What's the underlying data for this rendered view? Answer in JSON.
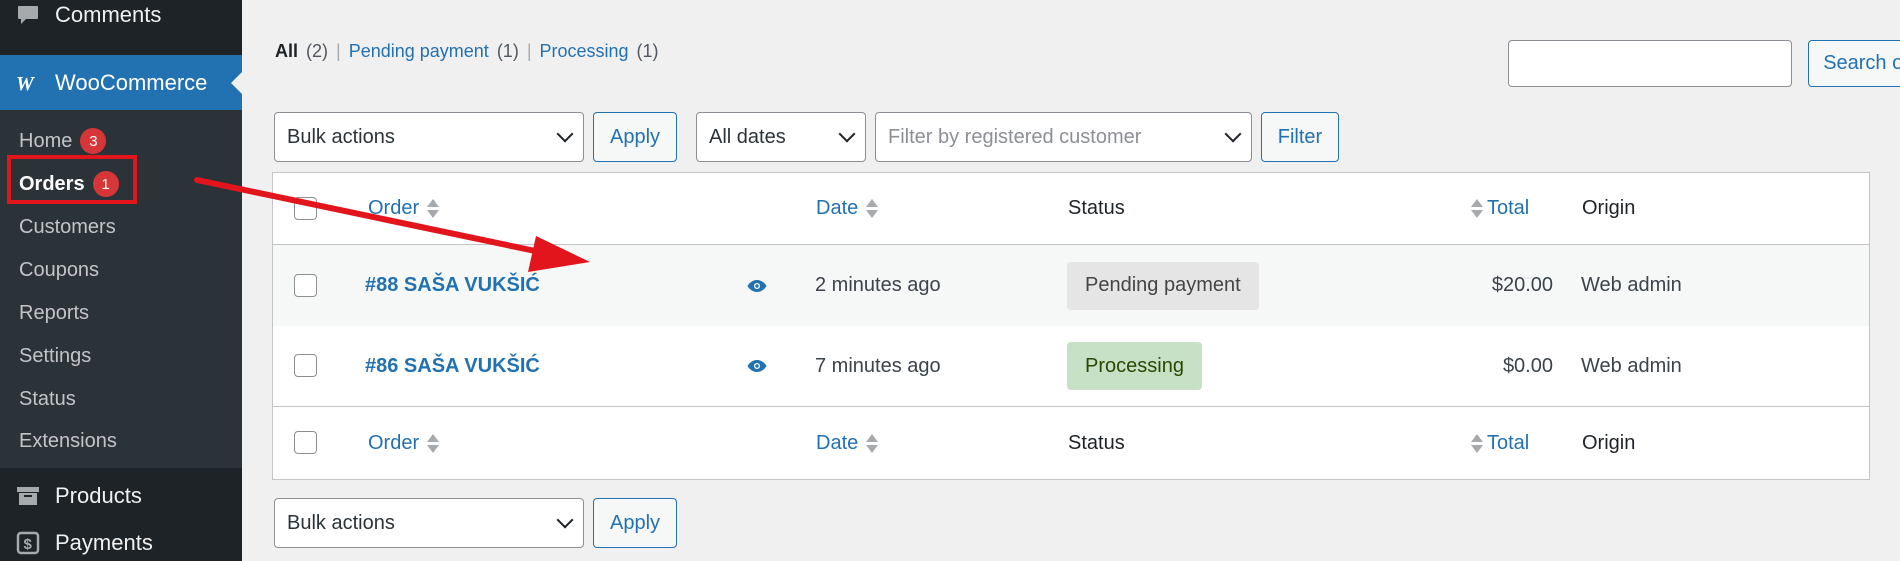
{
  "sidebar": {
    "comments_label": "Comments",
    "woocommerce_label": "WooCommerce",
    "submenu": [
      {
        "label": "Home",
        "badge": "3"
      },
      {
        "label": "Orders",
        "badge": "1"
      },
      {
        "label": "Customers"
      },
      {
        "label": "Coupons"
      },
      {
        "label": "Reports"
      },
      {
        "label": "Settings"
      },
      {
        "label": "Status"
      },
      {
        "label": "Extensions"
      }
    ],
    "products_label": "Products",
    "payments_label": "Payments"
  },
  "views": {
    "all_label": "All",
    "all_count": "(2)",
    "pending_label": "Pending payment",
    "pending_count": "(1)",
    "processing_label": "Processing",
    "processing_count": "(1)",
    "separator": "|"
  },
  "search": {
    "value": "",
    "button_label": "Search orders"
  },
  "filters": {
    "bulk_actions": "Bulk actions",
    "apply_label": "Apply",
    "dates": "All dates",
    "customer_placeholder": "Filter by registered customer",
    "filter_label": "Filter"
  },
  "table": {
    "columns": {
      "order": "Order",
      "date": "Date",
      "status": "Status",
      "total": "Total",
      "origin": "Origin"
    },
    "rows": [
      {
        "order": "#88 SAŠA VUKŠIĆ",
        "date": "2 minutes ago",
        "status": "Pending payment",
        "total": "$20.00",
        "origin": "Web admin"
      },
      {
        "order": "#86 SAŠA VUKŠIĆ",
        "date": "7 minutes ago",
        "status": "Processing",
        "total": "$0.00",
        "origin": "Web admin"
      }
    ]
  },
  "colors": {
    "sidebar_bg": "#1d2327",
    "accent": "#2271b1",
    "highlight": "#e2141c",
    "pending_bg": "#e5e5e5",
    "processing_bg": "#c6e1c6"
  }
}
